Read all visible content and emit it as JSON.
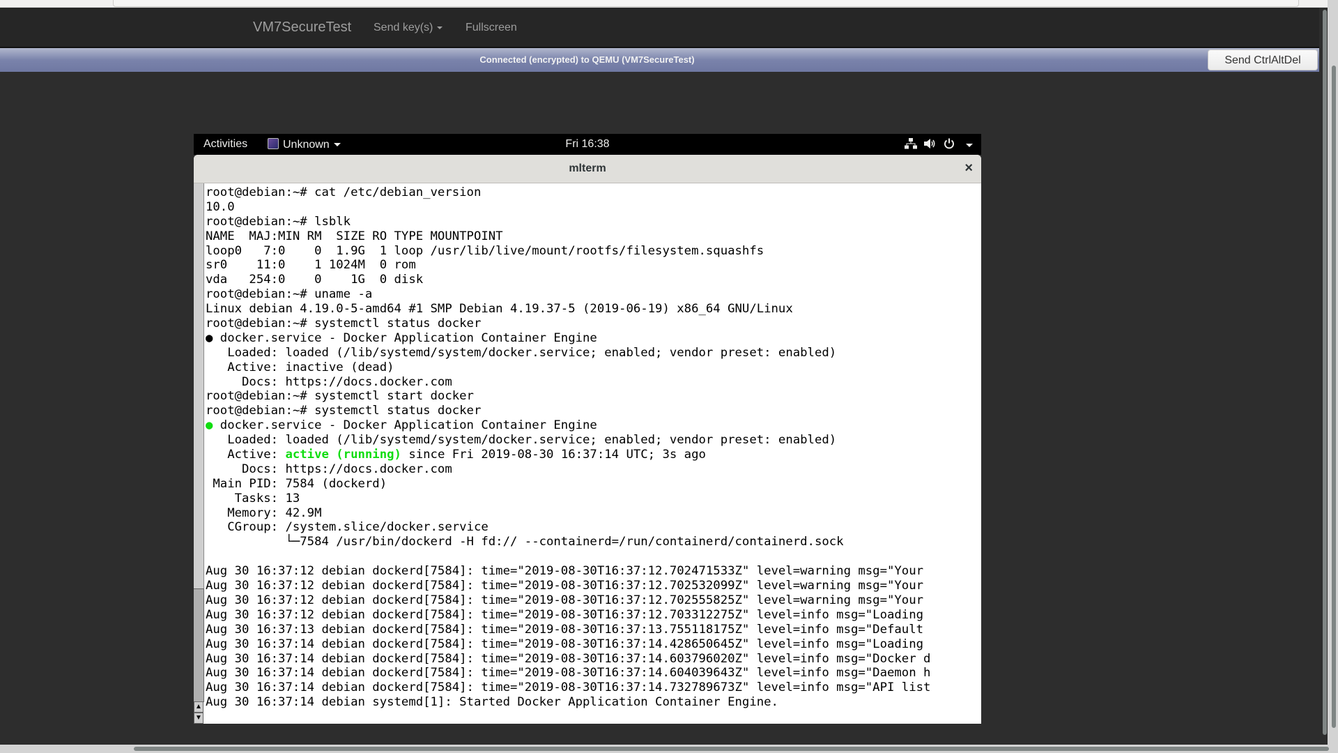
{
  "navbar": {
    "brand": "VM7SecureTest",
    "send_keys_label": "Send key(s)",
    "fullscreen_label": "Fullscreen"
  },
  "statusbar": {
    "text": "Connected (encrypted) to QEMU (VM7SecureTest)",
    "ctrl_alt_del_label": "Send CtrlAltDel"
  },
  "gnome_bar": {
    "activities": "Activities",
    "app_menu": "Unknown",
    "clock": "Fri 16:38",
    "tray_icons": [
      "network-icon",
      "volume-icon",
      "power-icon"
    ]
  },
  "terminal": {
    "title": "mlterm",
    "close_glyph": "×",
    "lines": [
      "root@debian:~# cat /etc/debian_version",
      "10.0",
      "root@debian:~# lsblk",
      "NAME  MAJ:MIN RM  SIZE RO TYPE MOUNTPOINT",
      "loop0   7:0    0  1.9G  1 loop /usr/lib/live/mount/rootfs/filesystem.squashfs",
      "sr0    11:0    1 1024M  0 rom",
      "vda   254:0    0    1G  0 disk",
      "root@debian:~# uname -a",
      "Linux debian 4.19.0-5-amd64 #1 SMP Debian 4.19.37-5 (2019-06-19) x86_64 GNU/Linux",
      "root@debian:~# systemctl status docker",
      "● docker.service - Docker Application Container Engine",
      "   Loaded: loaded (/lib/systemd/system/docker.service; enabled; vendor preset: enabled)",
      "   Active: inactive (dead)",
      "     Docs: https://docs.docker.com",
      "root@debian:~# systemctl start docker",
      "root@debian:~# systemctl status docker",
      " docker.service - Docker Application Container Engine",
      "   Loaded: loaded (/lib/systemd/system/docker.service; enabled; vendor preset: enabled)",
      "",
      "     Docs: https://docs.docker.com",
      " Main PID: 7584 (dockerd)",
      "    Tasks: 13",
      "   Memory: 42.9M",
      "   CGroup: /system.slice/docker.service",
      "           └─7584 /usr/bin/dockerd -H fd:// --containerd=/run/containerd/containerd.sock",
      "",
      "Aug 30 16:37:12 debian dockerd[7584]: time=\"2019-08-30T16:37:12.702471533Z\" level=warning msg=\"Your",
      "Aug 30 16:37:12 debian dockerd[7584]: time=\"2019-08-30T16:37:12.702532099Z\" level=warning msg=\"Your",
      "Aug 30 16:37:12 debian dockerd[7584]: time=\"2019-08-30T16:37:12.702555825Z\" level=warning msg=\"Your",
      "Aug 30 16:37:12 debian dockerd[7584]: time=\"2019-08-30T16:37:12.703312275Z\" level=info msg=\"Loading",
      "Aug 30 16:37:13 debian dockerd[7584]: time=\"2019-08-30T16:37:13.755118175Z\" level=info msg=\"Default",
      "Aug 30 16:37:14 debian dockerd[7584]: time=\"2019-08-30T16:37:14.428650645Z\" level=info msg=\"Loading",
      "Aug 30 16:37:14 debian dockerd[7584]: time=\"2019-08-30T16:37:14.603796020Z\" level=info msg=\"Docker d",
      "Aug 30 16:37:14 debian dockerd[7584]: time=\"2019-08-30T16:37:14.604039643Z\" level=info msg=\"Daemon h",
      "Aug 30 16:37:14 debian dockerd[7584]: time=\"2019-08-30T16:37:14.732789673Z\" level=info msg=\"API list",
      "Aug 30 16:37:14 debian systemd[1]: Started Docker Application Container Engine."
    ],
    "running_status_line": {
      "dot": "●",
      "active_prefix": "   Active: ",
      "active_state": "active (running)",
      "active_suffix": " since Fri 2019-08-30 16:37:14 UTC; 3s ago"
    },
    "status_color_running": "#11dd11"
  }
}
